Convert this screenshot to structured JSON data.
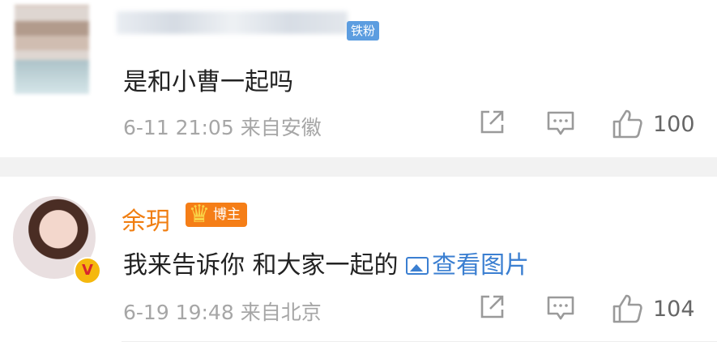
{
  "comments": [
    {
      "username": "",
      "badge": "铁粉",
      "text": "是和小曹一起吗",
      "date": "6-11 21:05",
      "source": "来自安徽",
      "likes": "100"
    },
    {
      "username": "余玥",
      "badge": "博主",
      "text": "我来告诉你 和大家一起的 ",
      "image_link": "查看图片",
      "date": "6-19 19:48",
      "source": "来自北京",
      "likes": "104",
      "verified_mark": "V"
    }
  ],
  "colors": {
    "username": "#f07e11",
    "link": "#3b7fd1",
    "fan_badge": "#5c9de0",
    "blogger_badge": "#f57e17"
  },
  "icons": [
    "share-icon",
    "comment-icon",
    "like-icon",
    "image-icon",
    "crown-icon"
  ]
}
